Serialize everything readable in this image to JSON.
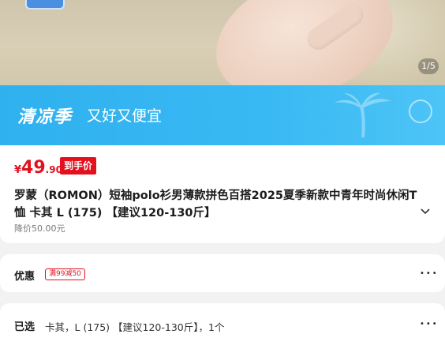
{
  "gallery": {
    "counter": "1/5"
  },
  "banner": {
    "title": "清凉季",
    "subtitle": "又好又便宜"
  },
  "price": {
    "currency": "¥",
    "integer": "49",
    "decimal": ".90",
    "tag": "到手价"
  },
  "product": {
    "title": "罗蒙（ROMON）短袖polo衫男薄款拼色百搭2025夏季新款中青年时尚休闲T恤 卡其 L (175) 【建议120-130斤】",
    "original_price": "降价50.00元"
  },
  "promo": {
    "label": "优惠",
    "coupon": "满99减50"
  },
  "selected": {
    "label": "已选",
    "value": "卡其，L (175) 【建议120-130斤】，1个"
  },
  "icons": {
    "expand": "chevron-down-icon",
    "more": "more-dots-icon"
  }
}
